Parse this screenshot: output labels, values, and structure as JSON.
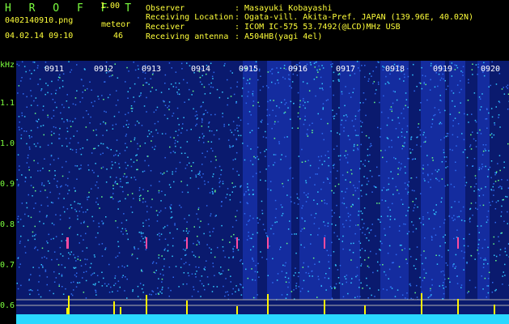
{
  "header": {
    "app_title": "H R O F F T",
    "app_version": "1.00",
    "file_name": "0402140910.png",
    "datetime": "04.02.14 09:10",
    "meteor_label": "meteor",
    "meteor_count": "46",
    "info": [
      {
        "label": "Observer",
        "value": ": Masayuki Kobayashi"
      },
      {
        "label": "Receiving Location",
        "value": ": Ogata-vill. Akita-Pref. JAPAN (139.96E, 40.02N)"
      },
      {
        "label": "Receiver",
        "value": ": ICOM IC-575 53.7492(@LCD)MHz USB"
      },
      {
        "label": "Receiving antenna",
        "value": ": A504HB(yagi 4el)"
      }
    ]
  },
  "spectrogram": {
    "unit": "kHz",
    "y_ticks": [
      "1.1",
      "1.0",
      "0.9",
      "0.8",
      "0.7",
      "0.6"
    ],
    "time_labels": [
      "0911",
      "0912",
      "0913",
      "0914",
      "0915",
      "0916",
      "0917",
      "0918",
      "0919",
      "0920"
    ],
    "colors": {
      "background": "#000000",
      "noise_dark": "#0a1a6e",
      "noise_mid": "#1e3cc8",
      "noise_light": "#2f6cf0",
      "speckle": "#33c8ff",
      "bright": "#66ff88",
      "baseline": "#29d8ff",
      "spike": "#fff600",
      "label": "#7cff3f"
    }
  }
}
